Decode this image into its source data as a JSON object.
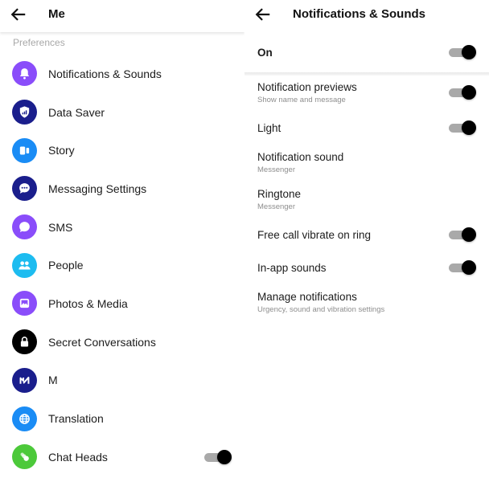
{
  "left": {
    "header": {
      "title": "Me",
      "back_icon": "arrow-left-icon"
    },
    "section_label": "Preferences",
    "items": [
      {
        "label": "Notifications & Sounds",
        "icon": "bell-icon",
        "color": "#8a4dfa"
      },
      {
        "label": "Data Saver",
        "icon": "shield-signal-icon",
        "color": "#1a1e8c"
      },
      {
        "label": "Story",
        "icon": "story-icon",
        "color": "#1a8cf5"
      },
      {
        "label": "Messaging Settings",
        "icon": "chat-bubble-dots-icon",
        "color": "#1a1e8c"
      },
      {
        "label": "SMS",
        "icon": "chat-bubble-icon",
        "color": "#8a4dfa"
      },
      {
        "label": "People",
        "icon": "people-icon",
        "color": "#1dbcf0"
      },
      {
        "label": "Photos & Media",
        "icon": "photo-icon",
        "color": "#8a4dfa"
      },
      {
        "label": "Secret Conversations",
        "icon": "lock-icon",
        "color": "#000000"
      },
      {
        "label": "M",
        "icon": "m-assistant-icon",
        "color": "#1a1e8c"
      },
      {
        "label": "Translation",
        "icon": "globe-icon",
        "color": "#1a8cf5"
      },
      {
        "label": "Chat Heads",
        "icon": "chat-heads-icon",
        "color": "#4cc93a",
        "toggle": true
      }
    ]
  },
  "right": {
    "header": {
      "title": "Notifications & Sounds",
      "back_icon": "arrow-left-icon"
    },
    "master": {
      "label": "On",
      "toggle": true
    },
    "rows": [
      {
        "title": "Notification previews",
        "subtitle": "Show name and message",
        "toggle": true
      },
      {
        "title": "Light",
        "subtitle": "",
        "toggle": true
      },
      {
        "title": "Notification sound",
        "subtitle": "Messenger",
        "toggle": false
      },
      {
        "title": "Ringtone",
        "subtitle": "Messenger",
        "toggle": false
      },
      {
        "title": "Free call vibrate on ring",
        "subtitle": "",
        "toggle": true
      },
      {
        "title": "In-app sounds",
        "subtitle": "",
        "toggle": true
      },
      {
        "title": "Manage notifications",
        "subtitle": "Urgency, sound and vibration settings",
        "toggle": false
      }
    ]
  }
}
